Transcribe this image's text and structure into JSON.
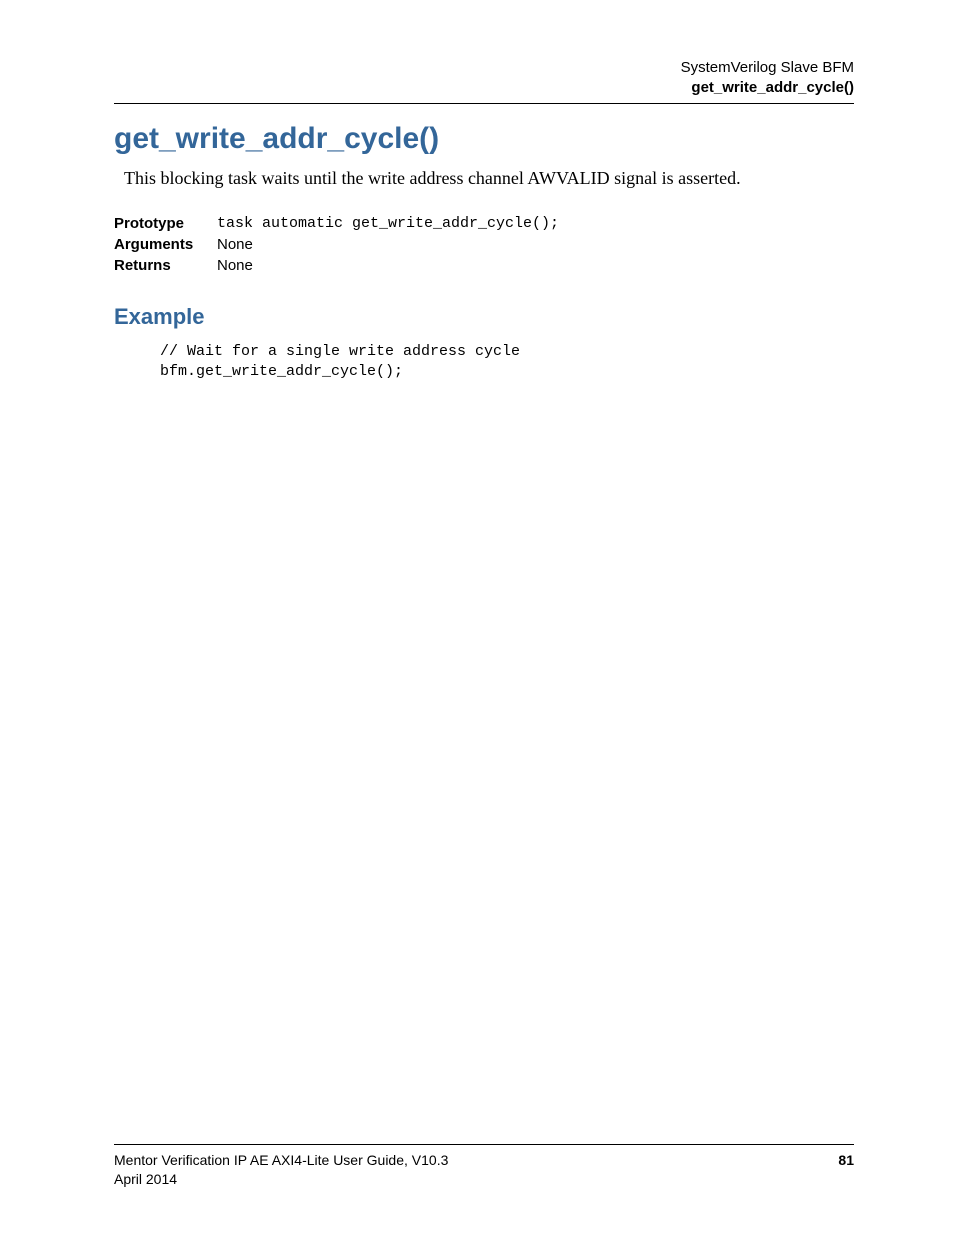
{
  "header": {
    "line1": "SystemVerilog Slave BFM",
    "line2": "get_write_addr_cycle()"
  },
  "title": "get_write_addr_cycle()",
  "description": "This blocking task waits until the write address channel AWVALID signal is asserted.",
  "signature": {
    "prototype_label": "Prototype",
    "prototype_value": "task automatic get_write_addr_cycle();",
    "arguments_label": "Arguments",
    "arguments_value": "None",
    "returns_label": "Returns",
    "returns_value": "None"
  },
  "example_heading": "Example",
  "example_code": "// Wait for a single write address cycle\nbfm.get_write_addr_cycle();",
  "footer": {
    "guide": "Mentor Verification IP AE AXI4-Lite User Guide, V10.3",
    "date": "April 2014",
    "page": "81"
  }
}
